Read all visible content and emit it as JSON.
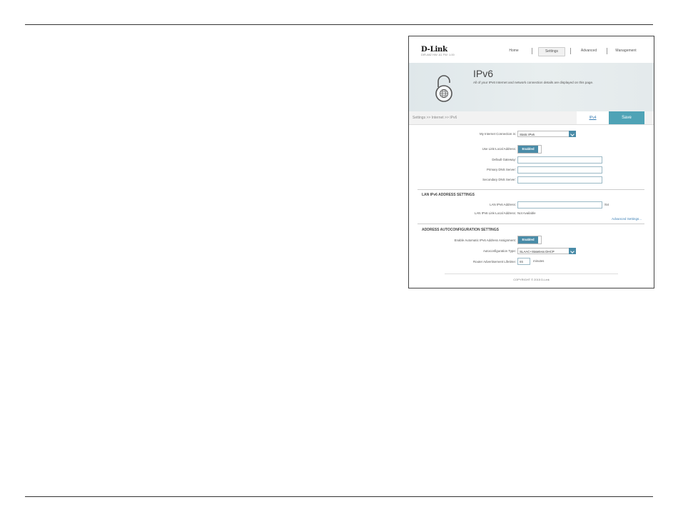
{
  "header": {
    "logo": "D-Link",
    "model": "DIR-882   HW: A1   FW: 1.00",
    "nav": [
      "Home",
      "Settings",
      "Advanced",
      "Management"
    ],
    "active_nav": "Settings"
  },
  "banner": {
    "title": "IPv6",
    "description": "All of your IPv6 Internet and network connection details are displayed on this page."
  },
  "crumb": "Settings >> Internet >> IPv6",
  "actions": {
    "ipv4_link": "IPv4",
    "save": "Save"
  },
  "form": {
    "connection_label": "My Internet Connection is:",
    "connection_value": "Static IPv6",
    "link_local_label": "Use Link-Local Address:",
    "link_local_value": "Enabled",
    "gateway_label": "Default Gateway:",
    "primary_dns_label": "Primary DNS Server:",
    "secondary_dns_label": "Secondary DNS Server:"
  },
  "lan": {
    "section_title": "LAN IPv6 ADDRESS SETTINGS",
    "address_label": "LAN IPv6 Address:",
    "prefix": "/64",
    "link_local_label": "LAN IPv6 Link-Local Address:",
    "link_local_value": "Not Available",
    "advanced_link": "Advanced Settings..."
  },
  "autoconfig": {
    "section_title": "ADDRESS AUTOCONFIGURATION SETTINGS",
    "enable_label": "Enable Automatic IPv6 Address Assignment:",
    "enable_value": "Enabled",
    "type_label": "Autoconfiguration Type:",
    "type_value": "SLAAC+Stateless DHCP",
    "lifetime_label": "Router Advertisement Lifetime:",
    "lifetime_value": "65",
    "lifetime_unit": "minutes"
  },
  "footer": {
    "copyright": "COPYRIGHT © 2015 D-Link"
  },
  "colors": {
    "accent": "#4a8ca8",
    "save": "#4fa3b6",
    "link": "#3a7fb5"
  },
  "icons": [
    "lock-globe-icon",
    "chevron-down-icon"
  ]
}
